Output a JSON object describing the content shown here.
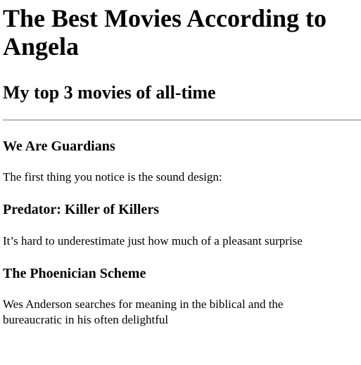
{
  "header": {
    "title": "The Best Movies According to Angela",
    "subtitle": "My top 3 movies of all-time"
  },
  "movies": [
    {
      "title": "We Are Guardians",
      "review": "The first thing you notice is the sound design:"
    },
    {
      "title": "Predator: Killer of Killers",
      "review": "It’s hard to underestimate just how much of a pleasant surprise"
    },
    {
      "title": "The Phoenician Scheme",
      "review": "Wes Anderson searches for meaning in the biblical and the bureaucratic in his often delightful"
    }
  ]
}
